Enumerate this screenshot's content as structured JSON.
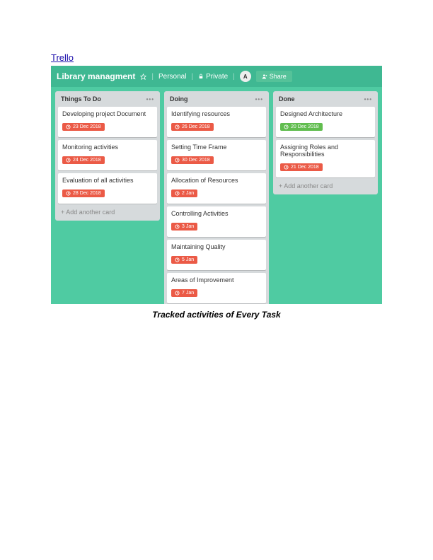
{
  "title": "Trello",
  "board": {
    "name": "Library managment",
    "visibility_personal": "Personal",
    "visibility_private": "Private",
    "avatar_initial": "A",
    "share_label": "Share"
  },
  "lists": [
    {
      "name": "Things To Do",
      "cards": [
        {
          "title": "Developing project Document",
          "date": "23 Dec 2018",
          "badge_color": "red"
        },
        {
          "title": "Monitoring activities",
          "date": "24 Dec 2018",
          "badge_color": "red"
        },
        {
          "title": "Evaluation of all activities",
          "date": "28 Dec 2018",
          "badge_color": "red"
        }
      ],
      "add_label": "Add another card"
    },
    {
      "name": "Doing",
      "cards": [
        {
          "title": "Identifying resources",
          "date": "26 Dec 2018",
          "badge_color": "red"
        },
        {
          "title": "Setting Time Frame",
          "date": "30 Dec 2018",
          "badge_color": "red"
        },
        {
          "title": "Allocation of Resources",
          "date": "2 Jan",
          "badge_color": "red"
        },
        {
          "title": "Controlling Activities",
          "date": "3 Jan",
          "badge_color": "red"
        },
        {
          "title": "Maintaining Quality",
          "date": "5 Jan",
          "badge_color": "red"
        },
        {
          "title": "Areas of Improvement",
          "date": "7 Jan",
          "badge_color": "red"
        }
      ],
      "add_label": "Add another card"
    },
    {
      "name": "Done",
      "cards": [
        {
          "title": "Designed Architecture",
          "date": "20 Dec 2018",
          "badge_color": "green"
        },
        {
          "title": "Assigning Roles and Responsibilities",
          "date": "21 Dec 2018",
          "badge_color": "red"
        }
      ],
      "add_label": "Add another card"
    }
  ],
  "caption": "Tracked activities of Every Task"
}
